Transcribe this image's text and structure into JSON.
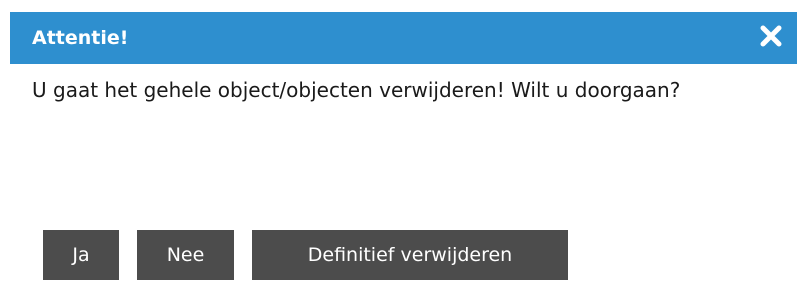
{
  "dialog": {
    "title": "Attentie!",
    "close_icon": "close-x-icon",
    "message": "U gaat het gehele object/objecten verwijderen! Wilt u doorgaan?",
    "buttons": {
      "yes_label": "Ja",
      "no_label": "Nee",
      "delete_label": "Definitief verwijderen"
    }
  },
  "colors": {
    "titlebar": "#2e8fcf",
    "button": "#4c4c4c",
    "text": "#1a1a1a"
  }
}
